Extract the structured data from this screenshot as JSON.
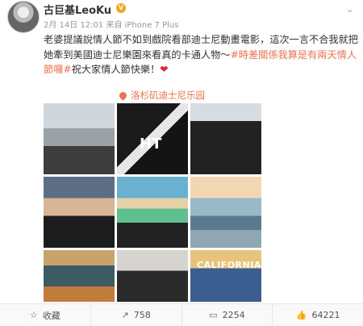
{
  "post": {
    "author": "古巨基LeoKu",
    "vip_badge": "V",
    "meta": "2月 14日 12:01 来自 iPhone 7 Plus",
    "text_prefix": "老婆提議說情人節不如到戲院看部迪士尼動畫電影，這次一言不合我就把她牽到美國迪士尼樂園來看真的卡通人物～",
    "tag": "#時差關係我算是有兩天情人節囉#",
    "text_suffix": "祝大家情人節快樂！",
    "heart": "❤",
    "location": "洛杉矶迪士尼乐园"
  },
  "photos": [
    {
      "name": "photo-castle",
      "overlay": ""
    },
    {
      "name": "photo-jacket-back",
      "overlay": "HT"
    },
    {
      "name": "photo-selfie-sunglasses",
      "overlay": ""
    },
    {
      "name": "photo-hand-sign",
      "overlay": ""
    },
    {
      "name": "photo-tshirt-park",
      "overlay": ""
    },
    {
      "name": "photo-lake-wheel",
      "overlay": ""
    },
    {
      "name": "photo-carousel",
      "overlay": ""
    },
    {
      "name": "photo-eating",
      "overlay": ""
    },
    {
      "name": "photo-california-adventure",
      "overlay": "CALIFORNIA"
    }
  ],
  "footer": {
    "favorite": "收藏",
    "repost": "758",
    "comment": "2254",
    "like": "64221"
  },
  "icons": {
    "favorite": "star-icon",
    "repost": "repost-icon",
    "comment": "comment-icon",
    "like": "thumbs-up-icon"
  }
}
